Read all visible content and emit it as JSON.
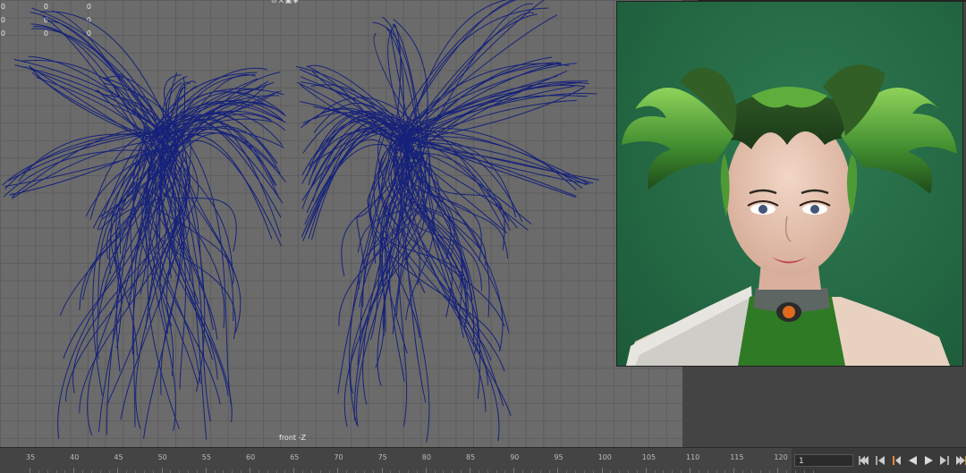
{
  "viewport": {
    "stats": [
      [
        "0",
        "0",
        "0"
      ],
      [
        "0",
        "0",
        "0"
      ],
      [
        "0",
        "0",
        "0"
      ]
    ],
    "camera_label": "front -Z",
    "view_icons": "⊙⚒▣◈"
  },
  "timeline": {
    "ticks": [
      "35",
      "40",
      "45",
      "50",
      "55",
      "60",
      "65",
      "70",
      "75",
      "80",
      "85",
      "90",
      "95",
      "100",
      "105",
      "110",
      "115",
      "120"
    ],
    "current_frame": "1",
    "transport": [
      "go-to-start-icon",
      "step-back-key-icon",
      "step-back-frame-icon",
      "play-backward-icon",
      "play-forward-icon",
      "step-forward-key-icon",
      "go-to-end-icon"
    ]
  },
  "colors": {
    "curve": "#16227a",
    "viewport_bg": "#6b6b6b",
    "render_bg": "#246944"
  }
}
